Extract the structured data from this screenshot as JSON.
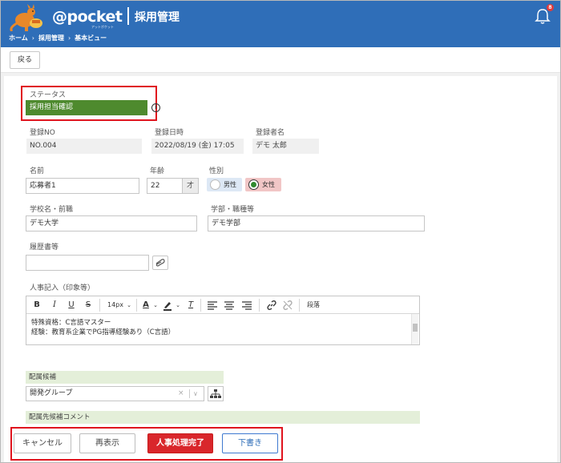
{
  "colors": {
    "header_bg": "#2f6eb8",
    "status_bg": "#4e8a2e",
    "highlight_border": "#e0141e",
    "primary_red": "#d9262b"
  },
  "header": {
    "logo_text": "@pocket",
    "logo_sub": "アットポケット",
    "title": "採用管理",
    "notification_count": "8",
    "breadcrumb": [
      "ホーム",
      "採用管理",
      "基本ビュー"
    ],
    "breadcrumb_sep": "›"
  },
  "toolbar": {
    "back_label": "戻る"
  },
  "form": {
    "status": {
      "label": "ステータス",
      "value": "採用担当確認",
      "info_icon": "ⓘ"
    },
    "reg_no": {
      "label": "登録NO",
      "value": "NO.004"
    },
    "reg_date": {
      "label": "登録日時",
      "value": "2022/08/19 (金) 17:05"
    },
    "registrant": {
      "label": "登録者名",
      "value": "デモ 太郎"
    },
    "name": {
      "label": "名前",
      "value": "応募者1"
    },
    "age": {
      "label": "年齢",
      "value": "22",
      "unit": "才"
    },
    "gender": {
      "label": "性別",
      "options": [
        "男性",
        "女性"
      ],
      "selected": "女性"
    },
    "school": {
      "label": "学校名・前職",
      "value": "デモ大学"
    },
    "faculty": {
      "label": "学部・職種等",
      "value": "デモ学部"
    },
    "resume": {
      "label": "履歴書等",
      "value": ""
    },
    "hr_notes": {
      "label": "人事記入（印象等）",
      "font_size": "14px",
      "format_label": "段落",
      "lines": [
        "特殊資格：C言語マスター",
        "経験：教育系企業でPG指導経験あり（C言語）"
      ]
    },
    "assignment": {
      "label": "配属候補",
      "value": "開発グループ",
      "clear": "×",
      "chevron": "∨"
    },
    "assignment_comment": {
      "label": "配属先候補コメント"
    }
  },
  "editor_toolbar": {
    "bold": "B",
    "italic": "I",
    "underline": "U",
    "strike": "S"
  },
  "footer": {
    "cancel": "キャンセル",
    "redisplay": "再表示",
    "complete": "人事処理完了",
    "draft": "下書き"
  }
}
